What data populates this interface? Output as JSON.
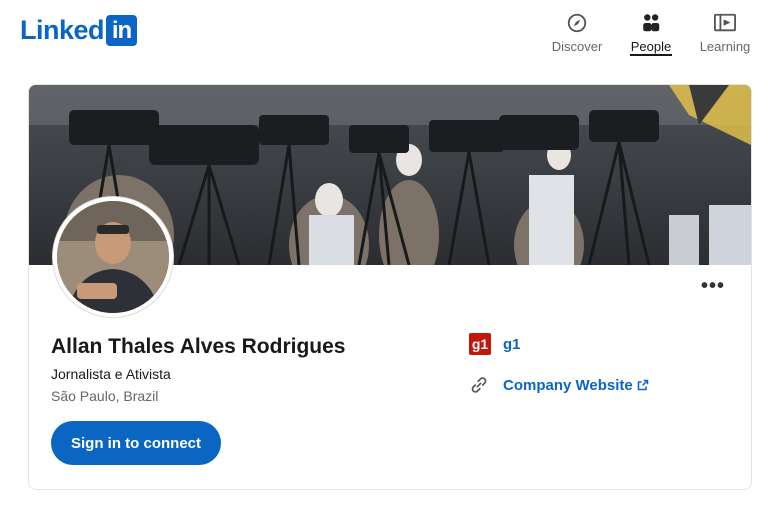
{
  "header": {
    "logo_text": "Linked",
    "logo_box": "in",
    "nav": [
      {
        "label": "Discover",
        "icon": "compass-icon",
        "active": false
      },
      {
        "label": "People",
        "icon": "people-icon",
        "active": true
      },
      {
        "label": "Learning",
        "icon": "video-icon",
        "active": false
      }
    ]
  },
  "profile": {
    "name": "Allan Thales Alves Rodrigues",
    "headline": "Jornalista e Ativista",
    "location": "São Paulo, Brazil",
    "connect_label": "Sign in to connect",
    "more_label": "•••",
    "company": {
      "logo_text": "g1",
      "name": "g1"
    },
    "website_label": "Company Website"
  },
  "colors": {
    "brand": "#0a66c2",
    "g1_red": "#c4170c"
  }
}
